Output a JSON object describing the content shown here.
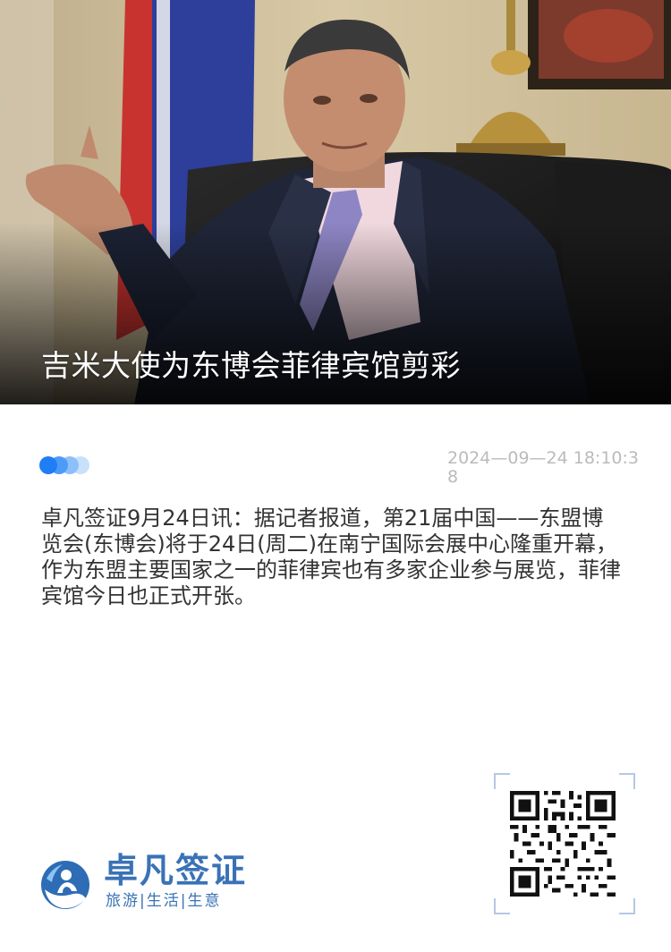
{
  "hero": {
    "title": "吉米大使为东博会菲律宾馆剪彩",
    "image": "ambassador-portrait"
  },
  "meta": {
    "timestamp": "2024—09—24 18:10:38"
  },
  "article": {
    "body": "卓凡签证9月24日讯：据记者报道，第21届中国——东盟博览会(东博会)将于24日(周二)在南宁国际会展中心隆重开幕，作为东盟主要国家之一的菲律宾也有多家企业参与展览，菲律宾馆今日也正式开张。"
  },
  "footer": {
    "brand_name": "卓凡签证",
    "slogan": "旅游|生活|生意",
    "logo_icon": "globe-person-logo",
    "qr_icon": "qr-code-icon"
  },
  "colors": {
    "brand_blue": "#3a72b6",
    "dot_primary": "#1f7ef5",
    "timestamp_gray": "#bbbbbb",
    "body_text": "#333333"
  }
}
